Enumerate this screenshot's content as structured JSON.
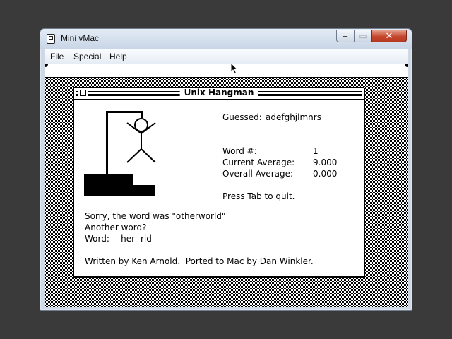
{
  "host_window": {
    "title": "Mini vMac",
    "menu": [
      "File",
      "Special",
      "Help"
    ],
    "controls": {
      "minimize": "‒",
      "maximize": "▭",
      "close": "✕"
    }
  },
  "mac_window": {
    "title": "Unix Hangman",
    "guessed_label": "Guessed:",
    "guessed_letters": "adefghjlmnrs",
    "stats": [
      {
        "label": "Word #:",
        "value": "1"
      },
      {
        "label": "Current Average:",
        "value": "9.000"
      },
      {
        "label": "Overall Average:",
        "value": "0.000"
      }
    ],
    "quit_hint": "Press Tab to quit.",
    "message_lines": [
      "Sorry, the word was \"otherworld\"",
      "Another word?",
      "Word:  --her--rld"
    ],
    "credits": "Written by Ken Arnold.  Ported to Mac by Dan Winkler."
  }
}
